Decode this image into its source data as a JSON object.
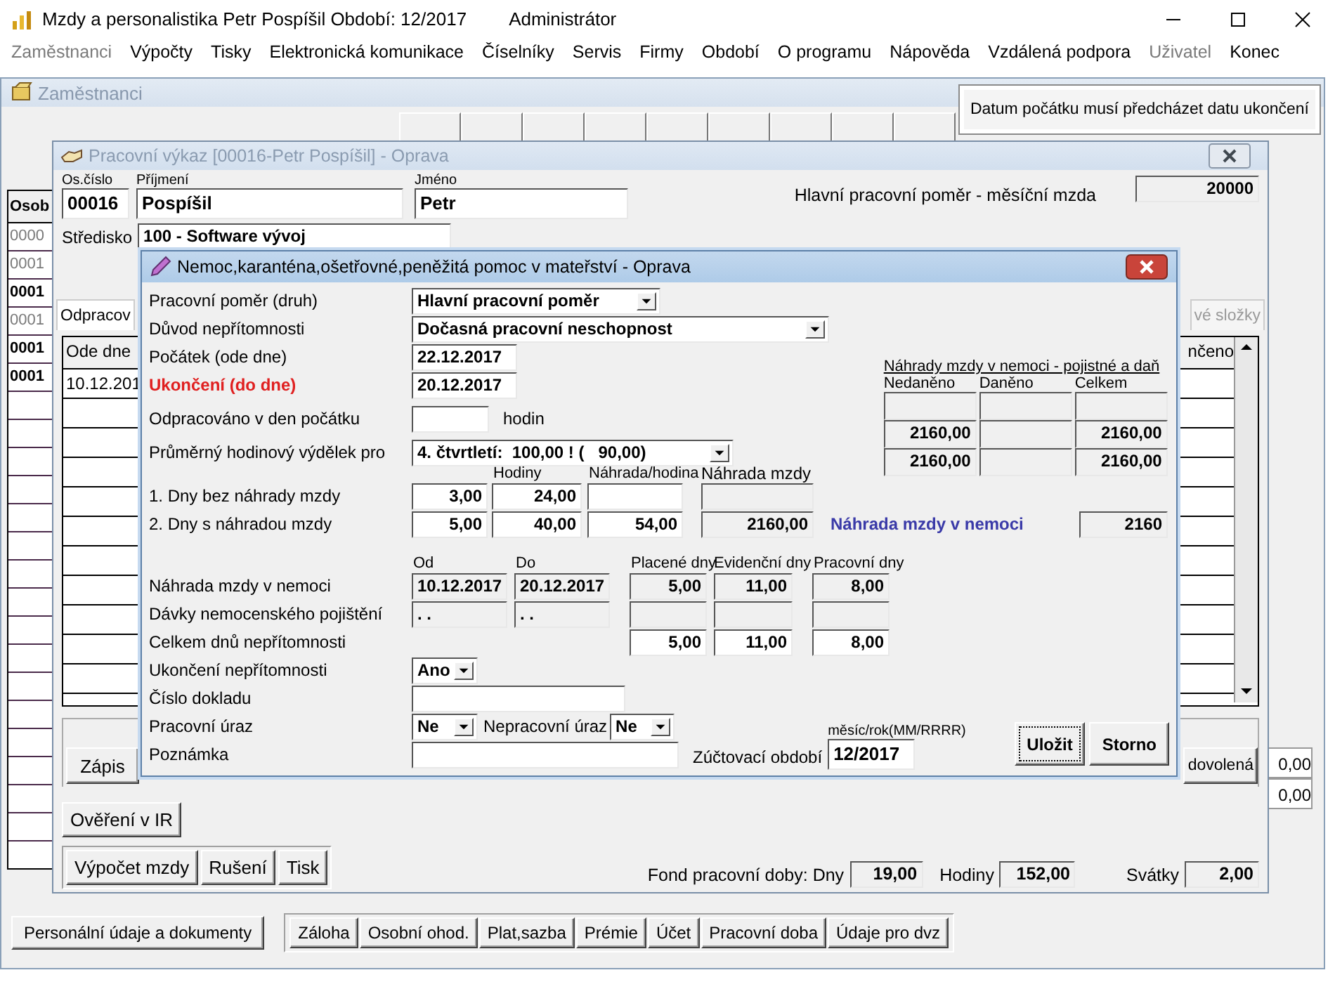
{
  "window": {
    "title": "Mzdy a personalistika  Petr Pospíšil Období: 12/2017",
    "user": "Administrátor"
  },
  "menu": [
    {
      "label": "Zaměstnanci",
      "disabled": true
    },
    {
      "label": "Výpočty",
      "disabled": false
    },
    {
      "label": "Tisky",
      "disabled": false
    },
    {
      "label": "Elektronická komunikace",
      "disabled": false
    },
    {
      "label": "Číselníky",
      "disabled": false
    },
    {
      "label": "Servis",
      "disabled": false
    },
    {
      "label": "Firmy",
      "disabled": false
    },
    {
      "label": "Období",
      "disabled": false
    },
    {
      "label": "O programu",
      "disabled": false
    },
    {
      "label": "Nápověda",
      "disabled": false
    },
    {
      "label": "Vzdálená podpora",
      "disabled": false
    },
    {
      "label": "Uživatel",
      "disabled": true
    },
    {
      "label": "Konec",
      "disabled": false
    }
  ],
  "employees": {
    "title": "Zaměstnanci",
    "column_1": "Osob",
    "rows": [
      {
        "text": "0000",
        "active": false
      },
      {
        "text": "0001",
        "active": false
      },
      {
        "text": "0001",
        "active": true
      },
      {
        "text": "0001",
        "active": false
      },
      {
        "text": "0001",
        "active": true
      },
      {
        "text": "0001",
        "active": true
      }
    ],
    "right_values": [
      "0,00",
      "0,00"
    ],
    "buttons_left": "Personální údaje a dokumenty",
    "buttons": [
      "Záloha",
      "Osobní ohod.",
      "Plat,sazba",
      "Prémie",
      "Účet",
      "Pracovní doba",
      "Údaje pro dvz"
    ]
  },
  "notice": "Datum počátku musí předcházet datu ukončení",
  "work": {
    "title": "Pracovní výkaz [00016-Petr Pospíšil] - Oprava",
    "number": {
      "label": "Os.číslo",
      "value": "00016"
    },
    "surname": {
      "label": "Příjmení",
      "value": "Pospíšil"
    },
    "name": {
      "label": "Jméno",
      "value": "Petr"
    },
    "salary": {
      "label": "Hlavní pracovní poměr - měsíční mzda",
      "value": "20000"
    },
    "centre": {
      "label": "Středisko",
      "value": "100   - Software vývoj"
    },
    "tabs": [
      {
        "label": "Odpracov",
        "selected": true
      },
      {
        "label": "vé složky",
        "selected": false
      }
    ],
    "table": {
      "column_1": "Ode dne",
      "column_2": "nčeno",
      "rows": [
        "10.12.201"
      ]
    },
    "entry_button": "Zápis",
    "leave_button": "dovolená",
    "verify_button": "Ověření v IR",
    "actions": [
      "Výpočet mzdy",
      "Rušení",
      "Tisk"
    ],
    "fund": {
      "label": "Fond pracovní doby: Dny",
      "days": "19,00",
      "hours_label": "Hodiny",
      "hours": "152,00",
      "holidays_label": "Svátky",
      "holidays": "2,00"
    }
  },
  "dialog": {
    "title": "Nemoc,karanténa,ošetřovné,peněžitá pomoc v mateřství - Oprava",
    "employment": {
      "label": "Pracovní poměr (druh)",
      "value": "Hlavní pracovní poměr"
    },
    "reason": {
      "label": "Důvod nepřítomnosti",
      "value": "Dočasná pracovní neschopnost"
    },
    "dates": [
      {
        "label": "Počátek  (ode dne)",
        "value": "22.12.2017",
        "error": false
      },
      {
        "label": "Ukončení (do dne)",
        "value": "20.12.2017",
        "error": true
      }
    ],
    "worked": {
      "label": "Odpracováno v den počátku",
      "unit": "hodin"
    },
    "average": {
      "label": "Průměrný hodinový výdělek pro",
      "value": "4. čtvrtletí:  100,00 ! (   90,00)"
    },
    "insurance": {
      "title": "Náhrady mzdy v nemoci - pojistné a daň",
      "columns": [
        "Nedaněno",
        "Daněno",
        "Celkem"
      ],
      "rows": [
        {
          "untaxed": "2160,00",
          "total": "2160,00"
        },
        {
          "untaxed": "2160,00",
          "total": "2160,00"
        }
      ]
    },
    "comp_headers": [
      "Hodiny",
      "Náhrada/hodina",
      "Náhrada mzdy"
    ],
    "comp_rows": [
      {
        "label": "1. Dny bez náhrady mzdy",
        "days": "3,00",
        "hours": "24,00"
      },
      {
        "label": "2. Dny s náhradou mzdy",
        "days": "5,00",
        "hours": "40,00",
        "rate": "54,00",
        "amount": "2160,00",
        "note": "Náhrada mzdy v nemoci",
        "total": "2160"
      }
    ],
    "period_headers": [
      "Od",
      "Do",
      "Placené dny",
      "Evidenční dny",
      "Pracovní dny"
    ],
    "period_rows": [
      {
        "kind": "readonly",
        "label": "Náhrada mzdy v nemoci",
        "from": "10.12.2017",
        "to": "20.12.2017",
        "paid": "5,00",
        "recorded": "11,00",
        "work": "8,00"
      },
      {
        "kind": "readonly",
        "label": "Dávky nemocenského pojištění",
        "from": ". .",
        "to": ". ."
      },
      {
        "kind": "total",
        "label": "Celkem dnů nepřítomnosti",
        "paid": "5,00",
        "recorded": "11,00",
        "work": "8,00"
      }
    ],
    "end_of_absence": {
      "label": "Ukončení nepřítomnosti",
      "value": "Ano"
    },
    "document": {
      "label": "Číslo dokladu"
    },
    "injury": {
      "label": "Pracovní úraz",
      "value": "Ne",
      "other_label": "Nepracovní úraz",
      "other_value": "Ne"
    },
    "note": {
      "label": "Poznámka"
    },
    "period": {
      "label": "Zúčtovací období",
      "hint": "měsíc/rok(MM/RRRR)",
      "value": "12/2017"
    },
    "buttons": [
      {
        "label": "Uložit",
        "focused": true
      },
      {
        "label": "Storno",
        "focused": false
      }
    ]
  }
}
